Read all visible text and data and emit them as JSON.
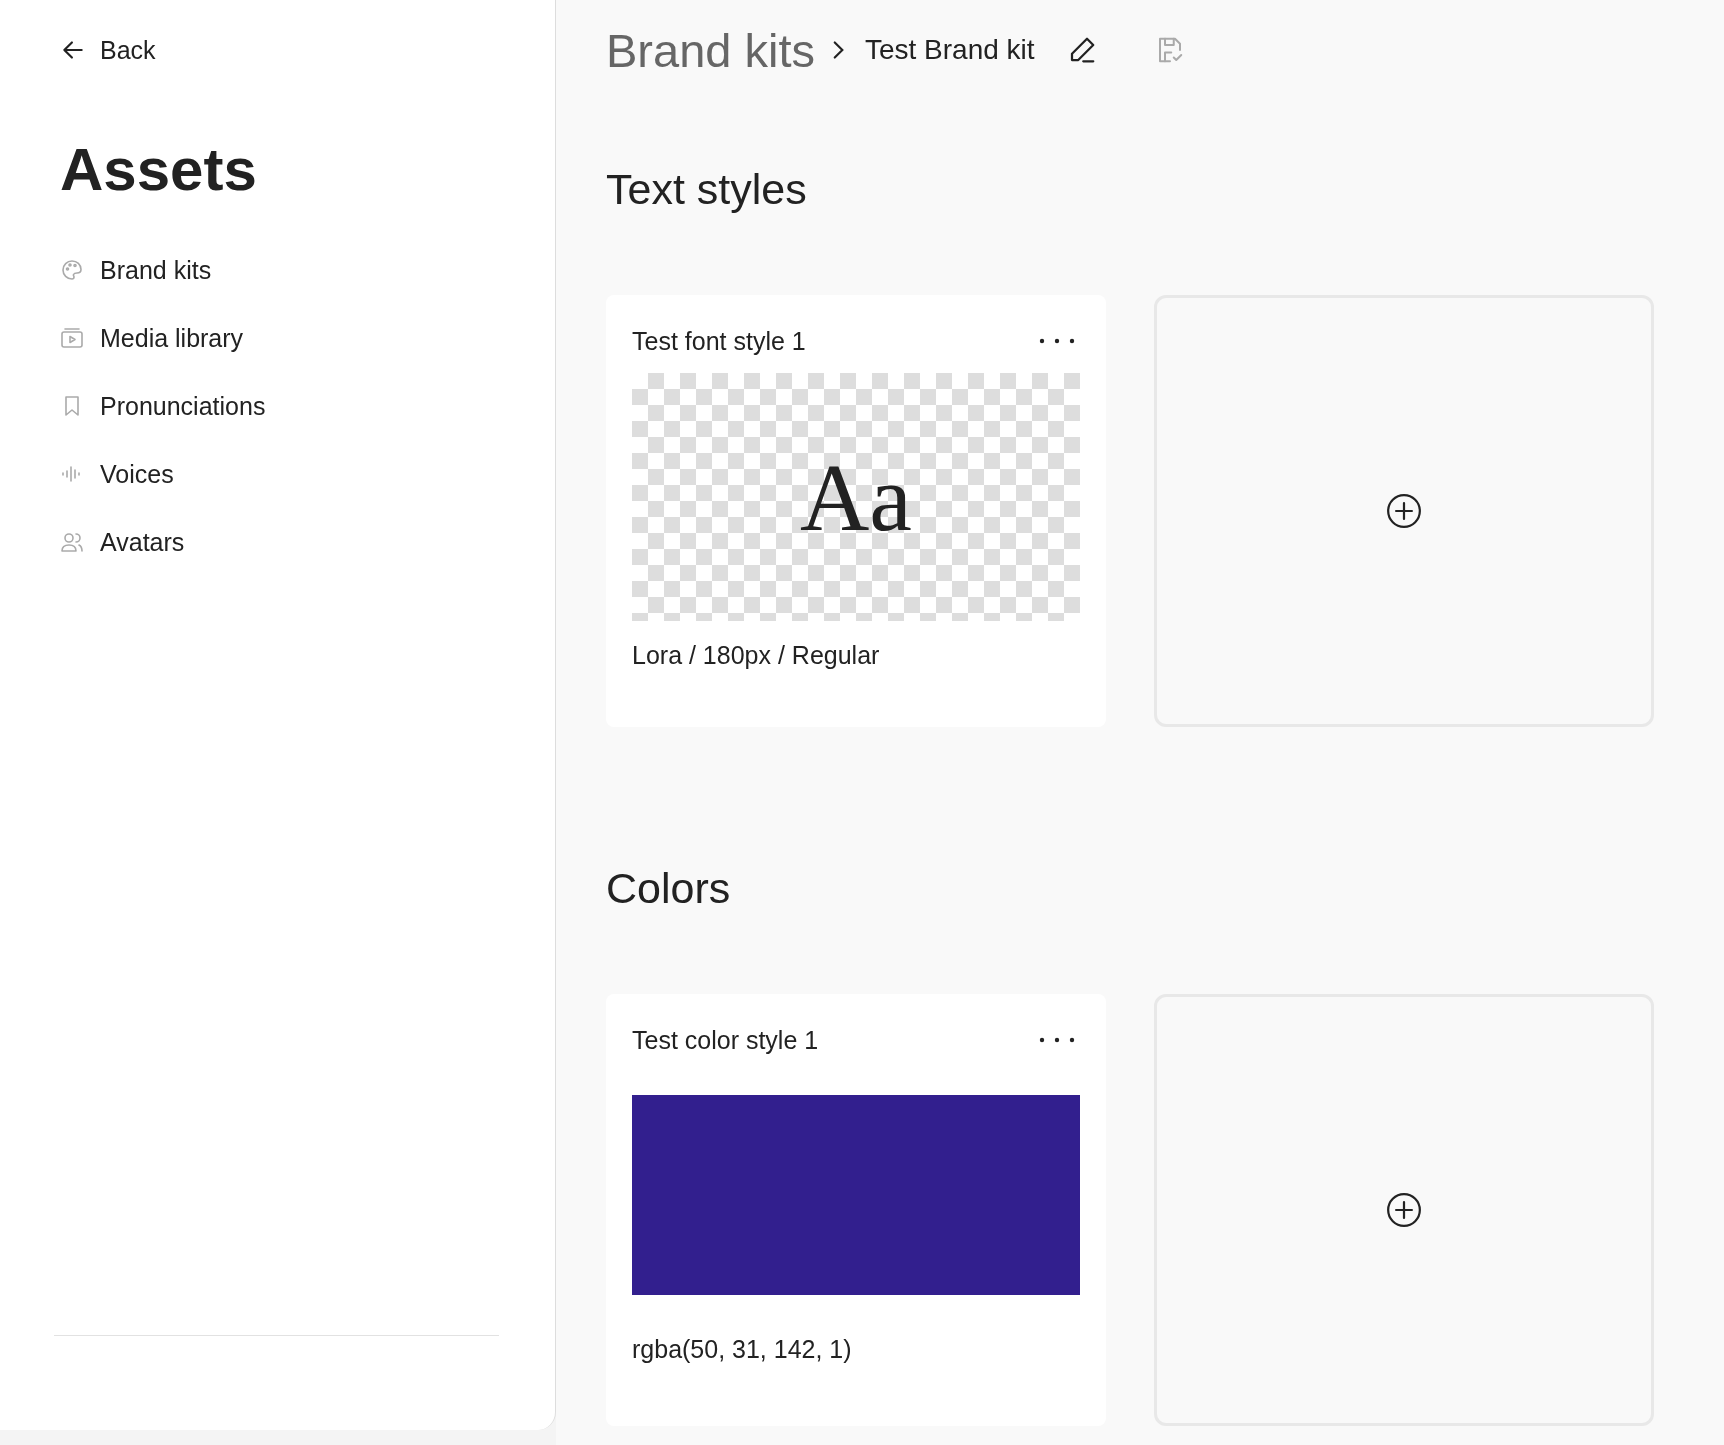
{
  "sidebar": {
    "back": "Back",
    "title": "Assets",
    "items": [
      {
        "label": "Brand kits"
      },
      {
        "label": "Media library"
      },
      {
        "label": "Pronunciations"
      },
      {
        "label": "Voices"
      },
      {
        "label": "Avatars"
      }
    ]
  },
  "breadcrumb": {
    "parent": "Brand kits",
    "current": "Test Brand kit"
  },
  "sections": [
    {
      "title": "Text styles",
      "styles": [
        {
          "kind": "font",
          "name": "Test font style 1",
          "sample": "Aa",
          "caption": "Lora / 180px / Regular"
        }
      ]
    },
    {
      "title": "Colors",
      "styles": [
        {
          "kind": "color",
          "name": "Test color style 1",
          "color": "#321f8e",
          "caption": "rgba(50, 31, 142, 1)"
        }
      ]
    }
  ]
}
